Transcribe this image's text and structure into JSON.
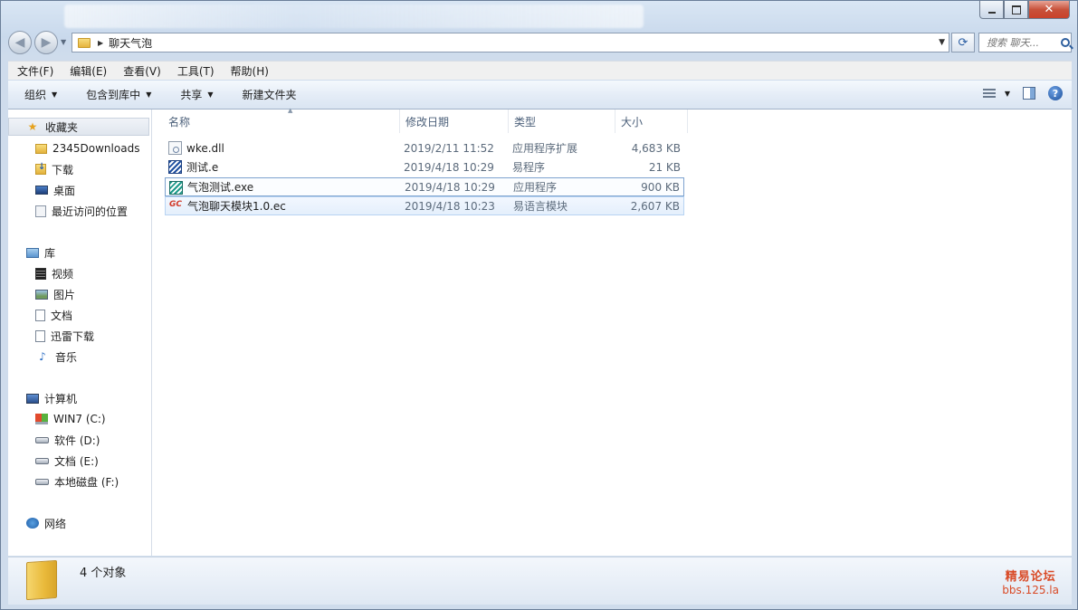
{
  "window": {
    "title": "",
    "controls": {
      "minimize": "",
      "maximize": "",
      "close": "✕"
    }
  },
  "address": {
    "path": [
      "聊天气泡"
    ],
    "search_placeholder": "搜索 聊天..."
  },
  "menu": [
    "文件(F)",
    "编辑(E)",
    "查看(V)",
    "工具(T)",
    "帮助(H)"
  ],
  "toolbar": {
    "organize": "组织",
    "include_library": "包含到库中",
    "share": "共享",
    "new_folder": "新建文件夹"
  },
  "sidebar": {
    "favorites": {
      "label": "收藏夹",
      "items": [
        "2345Downloads",
        "下载",
        "桌面",
        "最近访问的位置"
      ]
    },
    "libraries": {
      "label": "库",
      "items": [
        "视频",
        "图片",
        "文档",
        "迅雷下载",
        "音乐"
      ]
    },
    "computer": {
      "label": "计算机",
      "items": [
        "WIN7 (C:)",
        "软件 (D:)",
        "文档 (E:)",
        "本地磁盘 (F:)"
      ]
    },
    "network": {
      "label": "网络"
    }
  },
  "columns": {
    "name": "名称",
    "modified": "修改日期",
    "type": "类型",
    "size": "大小"
  },
  "files": [
    {
      "name": "wke.dll",
      "modified": "2019/2/11 11:52",
      "type": "应用程序扩展",
      "size": "4,683 KB",
      "icon": "dll-icon"
    },
    {
      "name": "测试.e",
      "modified": "2019/4/18 10:29",
      "type": "易程序",
      "size": "21 KB",
      "icon": "e-source-icon"
    },
    {
      "name": "气泡测试.exe",
      "modified": "2019/4/18 10:29",
      "type": "应用程序",
      "size": "900 KB",
      "icon": "exe-icon"
    },
    {
      "name": "气泡聊天模块1.0.ec",
      "modified": "2019/4/18 10:23",
      "type": "易语言模块",
      "size": "2,607 KB",
      "icon": "ec-module-icon"
    }
  ],
  "status": {
    "count_text": "4 个对象"
  },
  "watermark": {
    "line1": "精易论坛",
    "line2": "bbs.125.la"
  }
}
